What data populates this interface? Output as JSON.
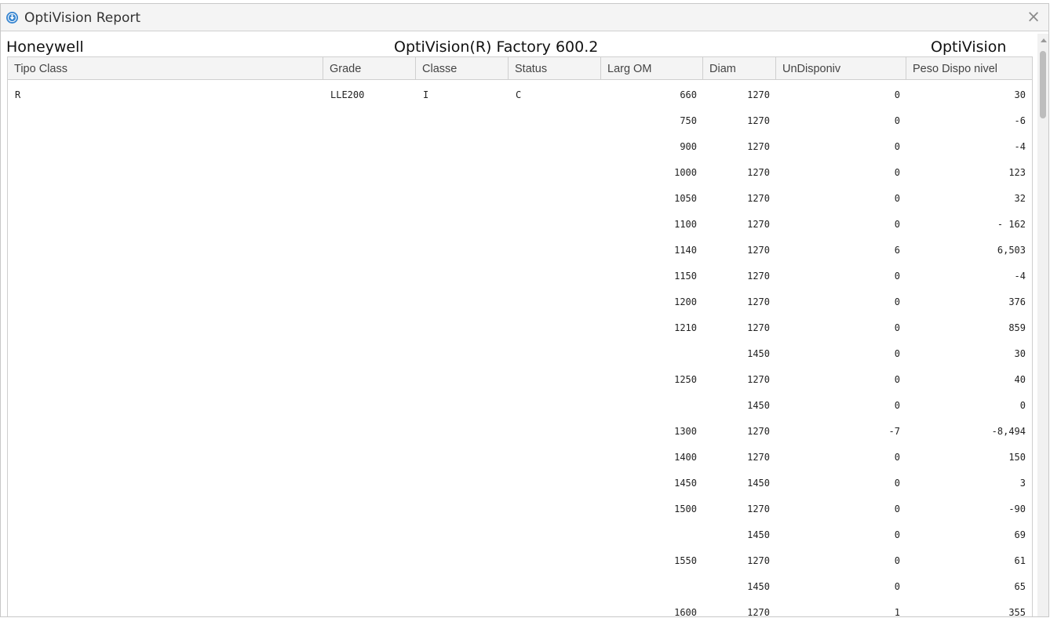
{
  "window": {
    "title": "OptiVision Report",
    "icon": "download-circle-icon",
    "close_glyph": "×"
  },
  "report_header": {
    "left": "Honeywell",
    "center": "OptiVision(R) Factory 600.2",
    "right": "OptiVision"
  },
  "columns": [
    "Tipo Class",
    "Grade",
    "Classe",
    "Status",
    "Larg OM",
    "Diam",
    "UnDisponiv",
    "Peso Dispo nivel"
  ],
  "rows": [
    {
      "tipo": "R",
      "grade": "LLE200",
      "classe": "I",
      "status": "C",
      "larg": "660",
      "diam": "1270",
      "undisp": "0",
      "peso": "30"
    },
    {
      "tipo": "",
      "grade": "",
      "classe": "",
      "status": "",
      "larg": "750",
      "diam": "1270",
      "undisp": "0",
      "peso": "-6"
    },
    {
      "tipo": "",
      "grade": "",
      "classe": "",
      "status": "",
      "larg": "900",
      "diam": "1270",
      "undisp": "0",
      "peso": "-4"
    },
    {
      "tipo": "",
      "grade": "",
      "classe": "",
      "status": "",
      "larg": "1000",
      "diam": "1270",
      "undisp": "0",
      "peso": "123"
    },
    {
      "tipo": "",
      "grade": "",
      "classe": "",
      "status": "",
      "larg": "1050",
      "diam": "1270",
      "undisp": "0",
      "peso": "32"
    },
    {
      "tipo": "",
      "grade": "",
      "classe": "",
      "status": "",
      "larg": "1100",
      "diam": "1270",
      "undisp": "0",
      "peso": "- 162"
    },
    {
      "tipo": "",
      "grade": "",
      "classe": "",
      "status": "",
      "larg": "1140",
      "diam": "1270",
      "undisp": "6",
      "peso": "6,503"
    },
    {
      "tipo": "",
      "grade": "",
      "classe": "",
      "status": "",
      "larg": "1150",
      "diam": "1270",
      "undisp": "0",
      "peso": "-4"
    },
    {
      "tipo": "",
      "grade": "",
      "classe": "",
      "status": "",
      "larg": "1200",
      "diam": "1270",
      "undisp": "0",
      "peso": "376"
    },
    {
      "tipo": "",
      "grade": "",
      "classe": "",
      "status": "",
      "larg": "1210",
      "diam": "1270",
      "undisp": "0",
      "peso": "859"
    },
    {
      "tipo": "",
      "grade": "",
      "classe": "",
      "status": "",
      "larg": "",
      "diam": "1450",
      "undisp": "0",
      "peso": "30"
    },
    {
      "tipo": "",
      "grade": "",
      "classe": "",
      "status": "",
      "larg": "1250",
      "diam": "1270",
      "undisp": "0",
      "peso": "40"
    },
    {
      "tipo": "",
      "grade": "",
      "classe": "",
      "status": "",
      "larg": "",
      "diam": "1450",
      "undisp": "0",
      "peso": "0"
    },
    {
      "tipo": "",
      "grade": "",
      "classe": "",
      "status": "",
      "larg": "1300",
      "diam": "1270",
      "undisp": "-7",
      "peso": "-8,494"
    },
    {
      "tipo": "",
      "grade": "",
      "classe": "",
      "status": "",
      "larg": "1400",
      "diam": "1270",
      "undisp": "0",
      "peso": "150"
    },
    {
      "tipo": "",
      "grade": "",
      "classe": "",
      "status": "",
      "larg": "1450",
      "diam": "1450",
      "undisp": "0",
      "peso": "3"
    },
    {
      "tipo": "",
      "grade": "",
      "classe": "",
      "status": "",
      "larg": "1500",
      "diam": "1270",
      "undisp": "0",
      "peso": "-90"
    },
    {
      "tipo": "",
      "grade": "",
      "classe": "",
      "status": "",
      "larg": "",
      "diam": "1450",
      "undisp": "0",
      "peso": "69"
    },
    {
      "tipo": "",
      "grade": "",
      "classe": "",
      "status": "",
      "larg": "1550",
      "diam": "1270",
      "undisp": "0",
      "peso": "61"
    },
    {
      "tipo": "",
      "grade": "",
      "classe": "",
      "status": "",
      "larg": "",
      "diam": "1450",
      "undisp": "0",
      "peso": "65"
    },
    {
      "tipo": "",
      "grade": "",
      "classe": "",
      "status": "",
      "larg": "1600",
      "diam": "1270",
      "undisp": "1",
      "peso": "355"
    }
  ],
  "colors": {
    "accent": "#3a87d1",
    "header_bg": "#f4f4f4",
    "border": "#cfcfcf"
  }
}
